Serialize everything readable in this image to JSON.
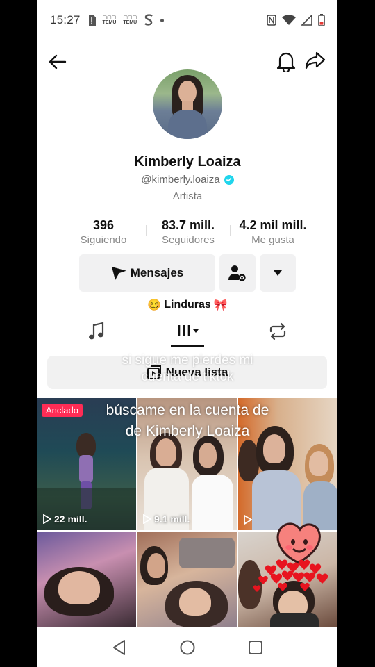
{
  "status_bar": {
    "time": "15:27",
    "temu_label_1": "TEMU",
    "temu_label_2": "TEMU",
    "icons": [
      "sim-alert-icon",
      "temu-icon",
      "temu-icon",
      "s-app-icon",
      "dot-icon",
      "nfc-icon",
      "wifi-icon",
      "signal-icon",
      "battery-low-icon"
    ],
    "battery_color": "#e53935"
  },
  "header": {
    "back_icon": "arrow-left-icon",
    "bell_icon": "bell-icon",
    "share_icon": "share-arrow-icon"
  },
  "profile": {
    "name": "Kimberly Loaiza",
    "handle": "@kimberly.loaiza",
    "verified_color": "#20d5ec",
    "category": "Artista"
  },
  "stats": [
    {
      "value": "396",
      "label": "Siguiendo"
    },
    {
      "value": "83.7 mill.",
      "label": "Seguidores"
    },
    {
      "value": "4.2 mil mill.",
      "label": "Me gusta"
    }
  ],
  "actions": {
    "messages_label": "Mensajes",
    "add_friend_icon": "user-settings-icon",
    "more_icon": "caret-down-icon"
  },
  "bio": {
    "text": "Linduras",
    "emoji_left": "🥴",
    "emoji_right": "🎀"
  },
  "tabs": [
    {
      "name": "music-icon",
      "active": false
    },
    {
      "name": "videos-grid-icon",
      "active": true
    },
    {
      "name": "repost-icon",
      "active": false
    }
  ],
  "playlist": {
    "label": "Nueva lista",
    "overlay_text_line1": "si sigue me pierdes mi",
    "overlay_text_line2": "cuenta de tiktok"
  },
  "video_overlay": {
    "line1": "búscame en la cuenta de",
    "line2": "de Kimberly Loaiza"
  },
  "videos": [
    {
      "pinned_label": "Anclado",
      "views": "22 mill."
    },
    {
      "views": "9.1 mill."
    },
    {
      "views": ""
    },
    {
      "views": ""
    },
    {
      "views": ""
    },
    {
      "views": ""
    }
  ],
  "nav": {
    "back": "triangle-back-icon",
    "home": "circle-home-icon",
    "recents": "square-recents-icon"
  },
  "accent_color": "#fe2c55"
}
